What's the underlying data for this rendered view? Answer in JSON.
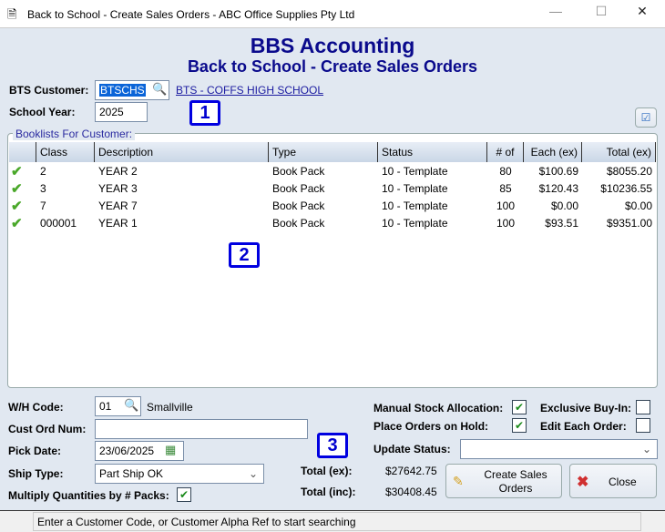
{
  "window": {
    "title": "Back to School - Create Sales Orders - ABC Office Supplies Pty Ltd",
    "minimize": "—",
    "maximize": "☐",
    "close": "✕"
  },
  "header": {
    "app": "BBS Accounting",
    "subtitle": "Back to School - Create Sales Orders"
  },
  "customer": {
    "label": "BTS Customer:",
    "code": "BTSCHS",
    "name_link": "BTS - COFFS HIGH SCHOOL"
  },
  "school_year": {
    "label": "School Year:",
    "value": "2025"
  },
  "badges": {
    "one": "1",
    "two": "2",
    "three": "3"
  },
  "grid": {
    "legend": "Booklists For Customer:",
    "columns": [
      "",
      "Class",
      "Description",
      "Type",
      "Status",
      "# of",
      "Each (ex)",
      "Total (ex)"
    ],
    "rows": [
      {
        "class": "2",
        "description": "YEAR 2",
        "type": "Book Pack",
        "status": "10 - Template",
        "num": "80",
        "each": "$100.69",
        "total": "$8055.20"
      },
      {
        "class": "3",
        "description": "YEAR 3",
        "type": "Book Pack",
        "status": "10 - Template",
        "num": "85",
        "each": "$120.43",
        "total": "$10236.55"
      },
      {
        "class": "7",
        "description": "YEAR  7",
        "type": "Book Pack",
        "status": "10 - Template",
        "num": "100",
        "each": "$0.00",
        "total": "$0.00"
      },
      {
        "class": "000001",
        "description": "YEAR 1",
        "type": "Book Pack",
        "status": "10 - Template",
        "num": "100",
        "each": "$93.51",
        "total": "$9351.00"
      }
    ]
  },
  "form": {
    "wh_label": "W/H Code:",
    "wh_code": "01",
    "wh_name": "Smallville",
    "cust_ord_label": "Cust Ord Num:",
    "cust_ord_value": "",
    "pick_label": "Pick Date:",
    "pick_value": "23/06/2025",
    "ship_label": "Ship Type:",
    "ship_value": "Part Ship OK",
    "multiply_label": "Multiply Quantities by # Packs:",
    "multiply_checked": true
  },
  "totals": {
    "ex_label": "Total (ex):",
    "ex_value": "$27642.75",
    "inc_label": "Total (inc):",
    "inc_value": "$30408.45"
  },
  "options": {
    "manual_label": "Manual Stock Allocation:",
    "manual_checked": true,
    "hold_label": "Place Orders on Hold:",
    "hold_checked": true,
    "exclusive_label": "Exclusive Buy-In:",
    "exclusive_checked": false,
    "edit_label": "Edit Each Order:",
    "edit_checked": false,
    "update_label": "Update Status:",
    "update_value": ""
  },
  "buttons": {
    "create": "Create Sales Orders",
    "close": "Close"
  },
  "status_bar": "Enter a Customer Code, or Customer Alpha Ref to start searching"
}
